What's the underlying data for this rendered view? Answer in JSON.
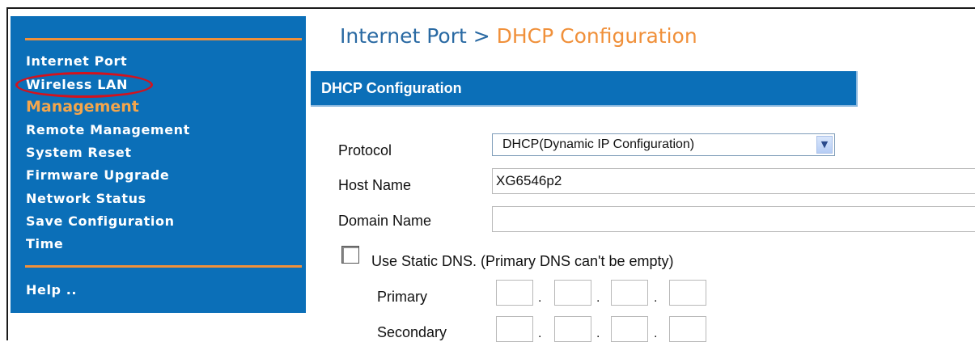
{
  "sidebar": {
    "items": [
      {
        "label": "Internet Port"
      },
      {
        "label": "Wireless LAN"
      }
    ],
    "heading": "Management",
    "management_items": [
      {
        "label": "Remote Management"
      },
      {
        "label": "System Reset"
      },
      {
        "label": "Firmware Upgrade"
      },
      {
        "label": "Network Status"
      },
      {
        "label": "Save Configuration"
      },
      {
        "label": "Time"
      }
    ],
    "help": "Help .."
  },
  "breadcrumb": {
    "parent": "Internet Port",
    "separator": " > ",
    "current": "DHCP Configuration"
  },
  "section": {
    "title": "DHCP Configuration"
  },
  "form": {
    "protocol_label": "Protocol",
    "protocol_value": "DHCP(Dynamic IP Configuration)",
    "host_name_label": "Host Name",
    "host_name_value": "XG6546p2",
    "domain_name_label": "Domain Name",
    "domain_name_value": "",
    "static_dns_label": "Use Static DNS. (Primary DNS can't be empty)",
    "static_dns_checked": false,
    "primary_label": "Primary",
    "secondary_label": "Secondary",
    "octet_separator": "."
  },
  "colors": {
    "sidebar_bg": "#0b6fb8",
    "accent_orange": "#f0903a",
    "breadcrumb_blue": "#2a6aa3",
    "highlight_ring": "#d4121c"
  }
}
